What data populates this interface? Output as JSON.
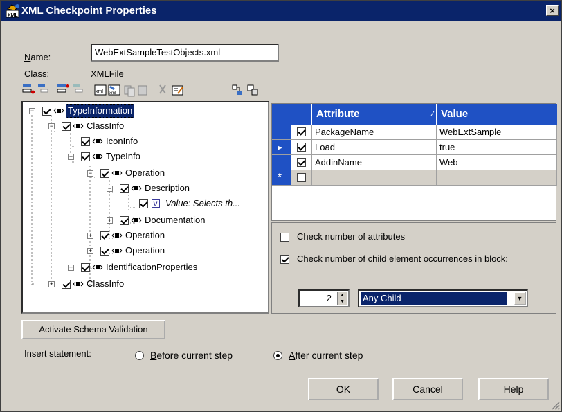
{
  "window": {
    "title": "XML Checkpoint Properties",
    "close_glyph": "×"
  },
  "name": {
    "label": "Name:",
    "value": "WebExtSampleTestObjects.xml"
  },
  "class": {
    "label": "Class:",
    "value": "XMLFile"
  },
  "toolbar": {
    "icons": [
      "add-element-icon",
      "add-child-icon",
      "insert-element-icon",
      "remove-element-icon",
      "xml-edit-icon",
      "xml-edit2-icon",
      "copy-icon",
      "paste-icon",
      "cut-icon",
      "edit-value-icon",
      "expand-icon",
      "collapse-icon"
    ]
  },
  "tree": {
    "nodes": [
      {
        "label": "TypeInformation",
        "selected": true
      },
      {
        "label": "ClassInfo"
      },
      {
        "label": "IconInfo"
      },
      {
        "label": "TypeInfo"
      },
      {
        "label": "Operation"
      },
      {
        "label": "Description"
      },
      {
        "label": "Value: Selects th...",
        "value_node": true
      },
      {
        "label": "Documentation"
      },
      {
        "label": "Operation"
      },
      {
        "label": "Operation"
      },
      {
        "label": "IdentificationProperties"
      },
      {
        "label": "ClassInfo"
      }
    ]
  },
  "grid": {
    "headers": {
      "attribute": "Attribute",
      "value": "Value"
    },
    "rows": [
      {
        "attribute": "PackageName",
        "value": "WebExtSample",
        "checked": true
      },
      {
        "attribute": "Load",
        "value": "true",
        "checked": true
      },
      {
        "attribute": "AddinName",
        "value": "Web",
        "checked": true
      }
    ],
    "new_row_marker": "*",
    "current_row_marker": "▸"
  },
  "options": {
    "check_attrs": "Check number of attributes",
    "check_child": "Check number of child element occurrences in block:",
    "count": "2",
    "child_select": "Any Child"
  },
  "schema_button": "Activate Schema Validation",
  "insert": {
    "label": "Insert statement:",
    "before": "Before current step",
    "after": "After current step",
    "selected": "after"
  },
  "buttons": {
    "ok": "OK",
    "cancel": "Cancel",
    "help": "Help"
  }
}
